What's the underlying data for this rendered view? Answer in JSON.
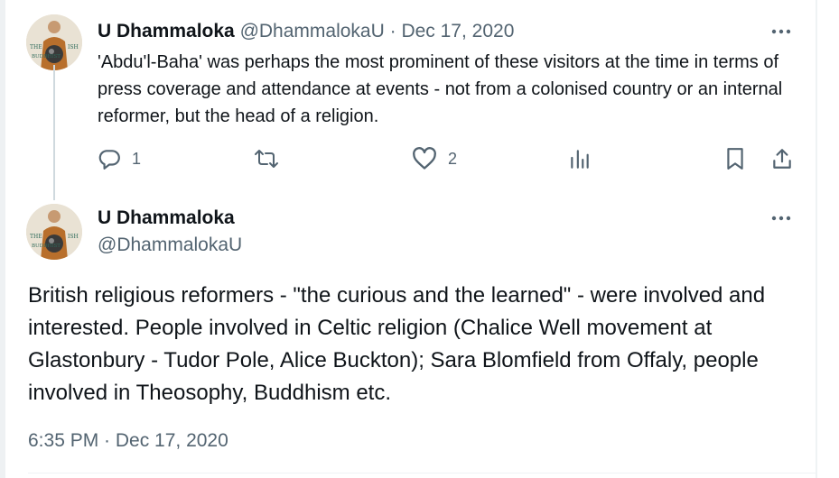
{
  "reply_tweet": {
    "author_name": "U Dhammaloka",
    "author_handle": "@DhammalokaU",
    "separator": "·",
    "date": "Dec 17, 2020",
    "text": "'Abdu'l-Baha' was perhaps the most prominent of these visitors at the time in terms of press coverage and attendance at events - not from a colonised country or an internal reformer, but the head of a religion.",
    "reply_count": "1",
    "like_count": "2",
    "avatar_caption": "THE IRISH BUDDHIST"
  },
  "main_tweet": {
    "author_name": "U Dhammaloka",
    "author_handle": "@DhammalokaU",
    "text": "British religious reformers - \"the curious and the learned\" - were involved and interested. People involved in Celtic religion (Chalice Well movement at Glastonbury - Tudor Pole, Alice Buckton); Sara Blomfield from Offaly, people involved in Theosophy, Buddhism etc.",
    "timestamp": "6:35 PM · Dec 17, 2020"
  },
  "icons": {
    "reply": "reply-icon",
    "retweet": "retweet-icon",
    "like": "heart-icon",
    "views": "views-icon",
    "bookmark": "bookmark-icon",
    "share": "share-icon",
    "more": "more-icon"
  },
  "colors": {
    "text": "#0f1419",
    "secondary": "#536471",
    "thread_line": "#cfd9de"
  }
}
